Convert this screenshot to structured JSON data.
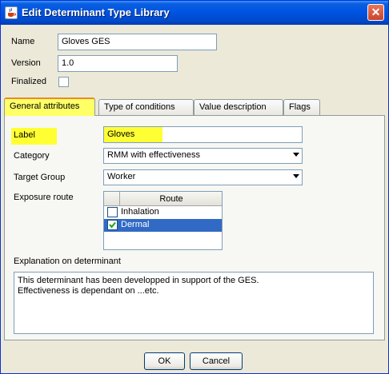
{
  "window": {
    "title": "Edit Determinant Type Library",
    "close_glyph": "✕"
  },
  "form": {
    "name_label": "Name",
    "name_value": "Gloves GES",
    "version_label": "Version",
    "version_value": "1.0",
    "finalized_label": "Finalized",
    "finalized_checked": false
  },
  "tabs": [
    "General attributes",
    "Type of conditions",
    "Value description",
    "Flags"
  ],
  "general": {
    "label_label": "Label",
    "label_value": "Gloves",
    "category_label": "Category",
    "category_value": "RMM with effectiveness",
    "target_group_label": "Target Group",
    "target_group_value": "Worker",
    "exposure_route_label": "Exposure route",
    "route_header": "Route",
    "routes": [
      {
        "name": "Inhalation",
        "checked": false,
        "selected": false
      },
      {
        "name": "Dermal",
        "checked": true,
        "selected": true
      }
    ],
    "explanation_label": "Explanation on determinant",
    "explanation_lines": [
      "This determinant has been developped in support of the GES.",
      "Effectiveness is dependant on ...etc."
    ]
  },
  "buttons": {
    "ok": "OK",
    "cancel": "Cancel"
  },
  "colors": {
    "highlight": "#ffff33",
    "selection": "#316ac5",
    "title_bar": "#0054e3"
  }
}
